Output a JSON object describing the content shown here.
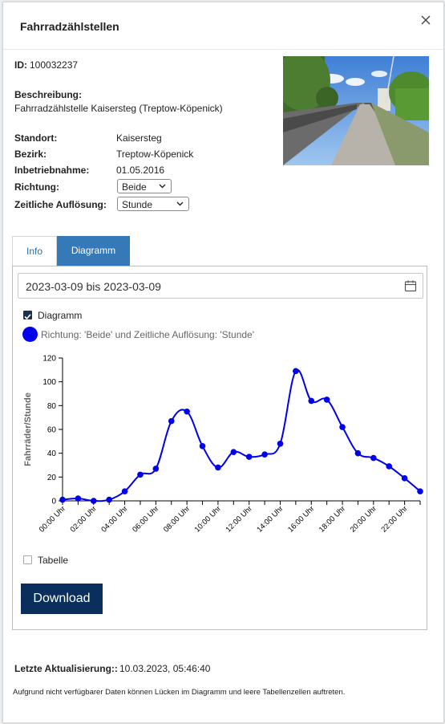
{
  "dialog": {
    "title": "Fahrradzählstellen"
  },
  "details": {
    "id_label": "ID:",
    "id_value": "100032237",
    "beschreibung_label": "Beschreibung:",
    "beschreibung_value": "Fahrradzählstelle Kaisersteg (Treptow-Köpenick)",
    "standort_label": "Standort:",
    "standort_value": "Kaisersteg",
    "bezirk_label": "Bezirk:",
    "bezirk_value": "Treptow-Köpenick",
    "inbetrieb_label": "Inbetriebnahme:",
    "inbetrieb_value": "01.05.2016",
    "richtung_label": "Richtung:",
    "richtung_value": "Beide",
    "aufloesung_label": "Zeitliche Auflösung:",
    "aufloesung_value": "Stunde"
  },
  "tabs": [
    {
      "label": "Info"
    },
    {
      "label": "Diagramm"
    }
  ],
  "diagram": {
    "date_range": "2023-03-09 bis 2023-03-09",
    "checkbox_diagram_label": "Diagramm",
    "legend_text": "Richtung: 'Beide' und Zeitliche Auflösung: 'Stunde'",
    "checkbox_table_label": "Tabelle",
    "download_label": "Download"
  },
  "chart_data": {
    "type": "line",
    "title": "",
    "xlabel": "",
    "ylabel": "Fahrräder/Stunde",
    "ylim": [
      0,
      120
    ],
    "yticks": [
      0,
      20,
      40,
      60,
      80,
      100,
      120
    ],
    "x_tick_labels": [
      "00:00 Uhr",
      "02:00 Uhr",
      "04:00 Uhr",
      "06:00 Uhr",
      "08:00 Uhr",
      "10:00 Uhr",
      "12:00 Uhr",
      "14:00 Uhr",
      "16:00 Uhr",
      "18:00 Uhr",
      "20:00 Uhr",
      "22:00 Uhr"
    ],
    "x_hours": [
      0,
      1,
      2,
      3,
      4,
      5,
      6,
      7,
      8,
      9,
      10,
      11,
      12,
      13,
      14,
      15,
      16,
      17,
      18,
      19,
      20,
      21,
      22,
      23
    ],
    "series": [
      {
        "values": [
          1,
          2,
          0,
          1,
          8,
          22,
          27,
          67,
          75,
          46,
          28,
          41,
          37,
          39,
          48,
          109,
          84,
          85,
          62,
          40,
          36,
          29,
          19,
          8
        ],
        "color": "#0000ee"
      }
    ],
    "legend": "top-left",
    "grid": false
  },
  "footer": {
    "update_label": "Letzte Aktualisierung::",
    "update_value": "10.03.2023, 05:46:40",
    "note": "Aufgrund nicht verfügbarer Daten können Lücken im Diagramm und leere Tabellenzellen auftreten."
  }
}
